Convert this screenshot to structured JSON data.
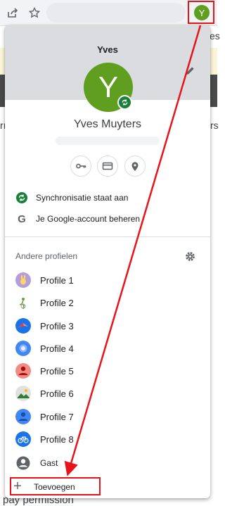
{
  "owner": {
    "first_name": "Yves",
    "full_name": "Yves Muyters",
    "avatar_letter": "Y",
    "avatar_color": "#5f9e1e"
  },
  "account_rows": {
    "sync_label": "Synchronisatie staat aan",
    "google_account_label": "Je Google-account beheren",
    "google_letter": "G"
  },
  "other_profiles": {
    "title": "Andere profielen",
    "profiles": [
      {
        "label": "Profile 1",
        "icon": "rabbit-icon",
        "color": "#b39ddb"
      },
      {
        "label": "Profile 2",
        "icon": "bike-icon",
        "color": "#ffffff"
      },
      {
        "label": "Profile 3",
        "icon": "origami-bird-icon",
        "color": "#1a73e8"
      },
      {
        "label": "Profile 4",
        "icon": "ball-icon",
        "color": "#4285f4"
      },
      {
        "label": "Profile 5",
        "icon": "person-icon",
        "color": "#f28b82"
      },
      {
        "label": "Profile 6",
        "icon": "landscape-icon",
        "color": "#e0e0e0"
      },
      {
        "label": "Profile 7",
        "icon": "person-icon",
        "color": "#4285f4"
      },
      {
        "label": "Profile 8",
        "icon": "bicycle-icon",
        "color": "#1a73e8"
      }
    ],
    "guest_label": "Gast",
    "add_label": "Toevoegen",
    "add_glyph": "+"
  },
  "background_text": {
    "frag_1": "es",
    "frag_2": "rı",
    "frag_3": "rs",
    "frag_bottom": "pay permission"
  },
  "annotation_color": "#e8141b"
}
